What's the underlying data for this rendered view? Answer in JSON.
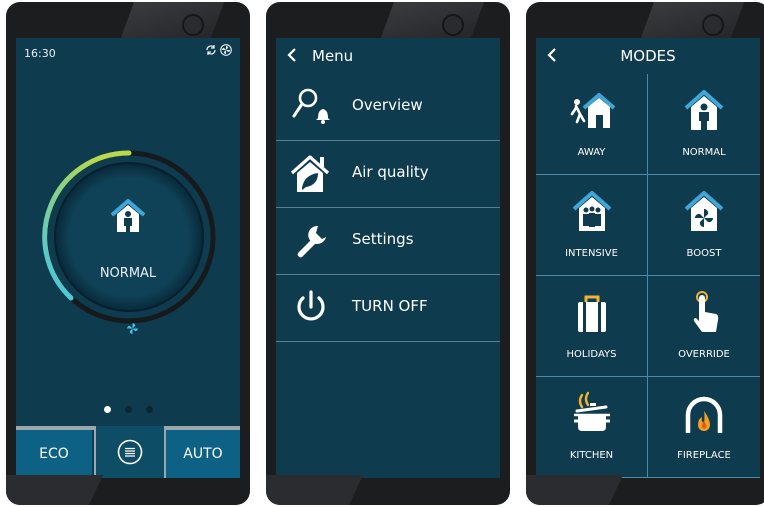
{
  "colors": {
    "screen_bg": "#0e3b4e",
    "accent_button": "#0c6184",
    "ring_start": "#3ec6e8",
    "ring_end": "#b9d84a",
    "icon_blue": "#3ea7d8"
  },
  "screen_home": {
    "time": "16:30",
    "status_icons": [
      "sync-icon",
      "fan-icon"
    ],
    "mode_label": "NORMAL",
    "mode_icon": "house-person-icon",
    "ring_progress_fraction": 0.5,
    "page_dots": {
      "count": 3,
      "active_index": 0
    },
    "bottom_bar": {
      "left_label": "ECO",
      "center_icon": "menu-list-icon",
      "right_label": "AUTO"
    }
  },
  "screen_menu": {
    "title": "Menu",
    "items": [
      {
        "label": "Overview",
        "icon": "overview-bell-icon"
      },
      {
        "label": "Air quality",
        "icon": "house-leaf-icon"
      },
      {
        "label": "Settings",
        "icon": "wrench-icon"
      },
      {
        "label": "TURN OFF",
        "icon": "power-icon"
      }
    ]
  },
  "screen_modes": {
    "title": "MODES",
    "modes": [
      {
        "label": "AWAY",
        "icon": "away-walker-icon"
      },
      {
        "label": "NORMAL",
        "icon": "house-person-icon"
      },
      {
        "label": "INTENSIVE",
        "icon": "house-people-icon"
      },
      {
        "label": "BOOST",
        "icon": "house-fan-icon"
      },
      {
        "label": "HOLIDAYS",
        "icon": "suitcase-icon"
      },
      {
        "label": "OVERRIDE",
        "icon": "hand-pointer-icon"
      },
      {
        "label": "KITCHEN",
        "icon": "cooking-pot-icon"
      },
      {
        "label": "FIREPLACE",
        "icon": "fireplace-icon"
      }
    ]
  }
}
